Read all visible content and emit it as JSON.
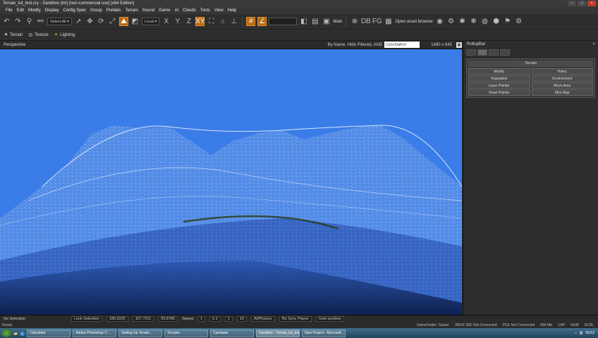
{
  "window": {
    "title": "Terrain_tut_test.cry - Sandbox (tm) [non-commercial use] [x64 Edition]",
    "buttons": [
      "–",
      "□",
      "×"
    ]
  },
  "menu": [
    "File",
    "Edit",
    "Modify",
    "Display",
    "Config Spec",
    "Group",
    "Prefabs",
    "Terrain",
    "Sound",
    "Game",
    "AI",
    "Clouds",
    "Tools",
    "View",
    "Help"
  ],
  "toolbar": {
    "select_all": "Select All",
    "coord_system": "Local",
    "axes": [
      "X",
      "Y",
      "Z"
    ],
    "main_label": "Main",
    "asset_browser": "Open asset browser",
    "fg_label": "FG",
    "db_label": "DB"
  },
  "toolbar2": {
    "terrain": "Terrain",
    "texture": "Texture",
    "lighting": "Lighting"
  },
  "viewport": {
    "label": "Perspective",
    "filter": "By Name, Hide Filtered, AND",
    "search_placeholder": "Ctrl+Shift+F",
    "resolution": "1480 x 845"
  },
  "rollup": {
    "title": "RollupBar",
    "close": "×",
    "group_title": "Terrain",
    "buttons": [
      "Modify",
      "Holes",
      "Vegetation",
      "Environment",
      "Layer Painter",
      "Move Area",
      "Voxel Painter",
      "Mini Map"
    ]
  },
  "status": {
    "selection": "No Selection",
    "lock": "Lock Selection",
    "x": "180.3325",
    "y": "167.7211",
    "z": "55.8785",
    "speed_label": "Speed",
    "speed": "1",
    "speed_options": [
      "0.1",
      "1",
      "10"
    ],
    "ai_physics": "AI/Physics",
    "no_sync": "No Sync Player",
    "goto": "Goto position"
  },
  "readybar": {
    "ready": "Ready",
    "gamefolder": "GameFolder: 'Game'",
    "xbox": "XBOX 360: Not Connected",
    "ps3": "PS3: Not Connected",
    "mem": "584 Mb",
    "caps": "CAP",
    "num": "NUM",
    "scrl": "SCRL"
  },
  "taskbar": {
    "tasks": [
      "Calculator",
      "Adobe Photoshop C...",
      "Setting Up Terrain...",
      "Terrains",
      "Camtasia",
      "Sandbox - Terrain_tut_test.cry",
      "New Project - Microsoft..."
    ],
    "clock": "06:52"
  },
  "colors": {
    "viewport_sky": "#3a7de8",
    "active_tool": "#b86a12",
    "wireframe": "#ffffff"
  }
}
